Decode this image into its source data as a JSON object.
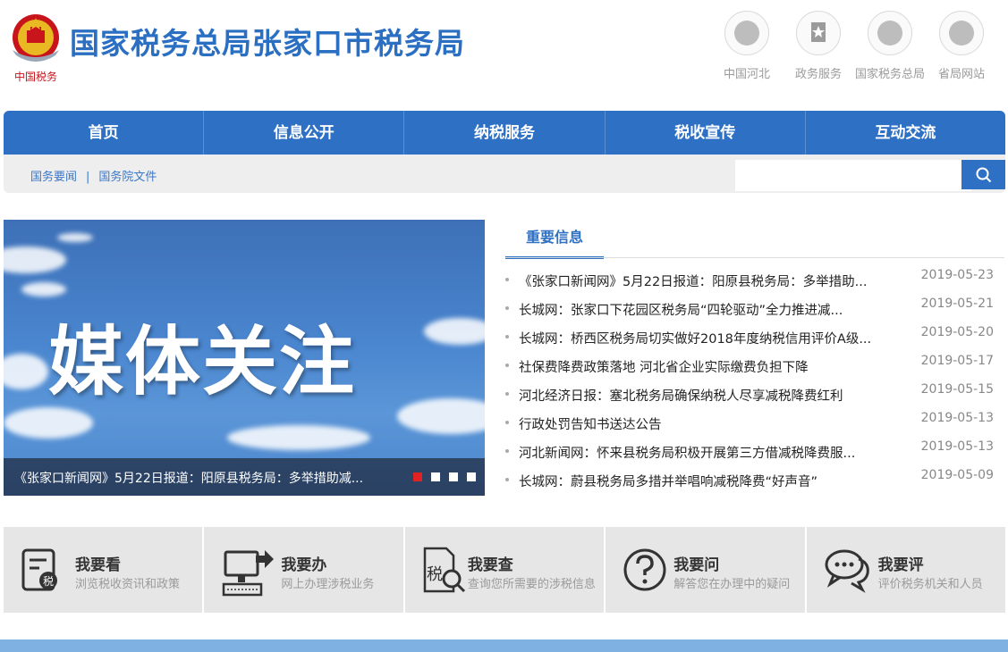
{
  "header": {
    "title": "国家税务总局张家口市税务局",
    "emblem_text": "中国税务",
    "quick_links": [
      {
        "label": "中国河北",
        "icon": "hebei-badge-icon"
      },
      {
        "label": "政务服务",
        "icon": "star-bookmark-icon"
      },
      {
        "label": "国家税务总局",
        "icon": "tax-bureau-icon"
      },
      {
        "label": "省局网站",
        "icon": "province-bureau-icon"
      }
    ]
  },
  "nav": {
    "items": [
      "首页",
      "信息公开",
      "纳税服务",
      "税收宣传",
      "互动交流"
    ],
    "sub_links": [
      "国务要闻",
      "国务院文件"
    ],
    "search": {
      "placeholder": "",
      "value": ""
    }
  },
  "carousel": {
    "slide_text": "媒体关注",
    "caption": "《张家口新闻网》5月22日报道：阳原县税务局：多举措助减...",
    "dot_count": 4,
    "active_dot": 0
  },
  "important_info": {
    "tab_label": "重要信息",
    "items": [
      {
        "title": "《张家口新闻网》5月22日报道：阳原县税务局：多举措助...",
        "date": "2019-05-23"
      },
      {
        "title": "长城网：张家口下花园区税务局“四轮驱动”全力推进减...",
        "date": "2019-05-21"
      },
      {
        "title": "长城网：桥西区税务局切实做好2018年度纳税信用评价A级...",
        "date": "2019-05-20"
      },
      {
        "title": "社保费降费政策落地 河北省企业实际缴费负担下降",
        "date": "2019-05-17"
      },
      {
        "title": "河北经济日报：塞北税务局确保纳税人尽享减税降费红利",
        "date": "2019-05-15"
      },
      {
        "title": "行政处罚告知书送达公告",
        "date": "2019-05-13"
      },
      {
        "title": "河北新闻网：怀来县税务局积极开展第三方借减税降费服...",
        "date": "2019-05-13"
      },
      {
        "title": "长城网：蔚县税务局多措并举唱响减税降费“好声音”",
        "date": "2019-05-09"
      }
    ]
  },
  "services": [
    {
      "title": "我要看",
      "desc": "浏览税收资讯和政策",
      "icon": "tax-document-icon",
      "icon_text": "税"
    },
    {
      "title": "我要办",
      "desc": "网上办理涉税业务",
      "icon": "computer-terminal-icon"
    },
    {
      "title": "我要查",
      "desc": "查询您所需要的涉税信息",
      "icon": "tax-search-icon",
      "icon_text": "税"
    },
    {
      "title": "我要问",
      "desc": "解答您在办理中的疑问",
      "icon": "question-icon"
    },
    {
      "title": "我要评",
      "desc": "评价税务机关和人员",
      "icon": "chat-bubbles-icon"
    }
  ],
  "colors": {
    "primary": "#2d70c4",
    "title_blue": "#2a6fc1",
    "active_dot": "#e02222",
    "footer_strip": "#7fb1e3"
  }
}
